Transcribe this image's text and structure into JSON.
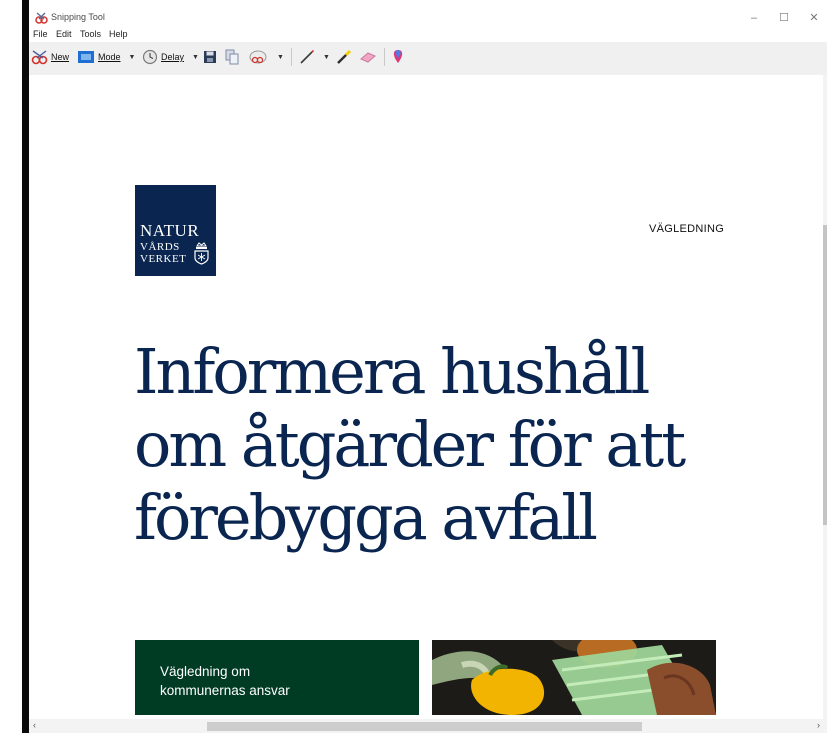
{
  "window": {
    "title": "Snipping Tool",
    "controls": {
      "minimize": "–",
      "maximize": "☐",
      "close": "✕"
    }
  },
  "menu": {
    "items": [
      "File",
      "Edit",
      "Tools",
      "Help"
    ]
  },
  "toolbar": {
    "new_label": "New",
    "mode_label": "Mode",
    "delay_label": "Delay",
    "icons": [
      "scissors-icon",
      "mode-rectangle-icon",
      "clock-icon",
      "save-icon",
      "copy-icon",
      "send-email-icon",
      "pen-icon",
      "highlighter-icon",
      "eraser-icon",
      "paint3d-icon"
    ]
  },
  "page": {
    "logo": {
      "line1": "NATUR",
      "line2": "VÅRDS",
      "line3": "VERKET"
    },
    "nav_label": "VÄGLEDNING",
    "headline": [
      "Informera hushåll",
      "om åtgärder för att",
      "förebygga avfall"
    ],
    "card": {
      "line1": "Vägledning om",
      "line2": "kommunernas ansvar"
    },
    "photo_alt": "vegetables"
  },
  "colors": {
    "navy": "#0a2650",
    "green": "#003b24",
    "toolbar_bg": "#f0f0f0"
  }
}
